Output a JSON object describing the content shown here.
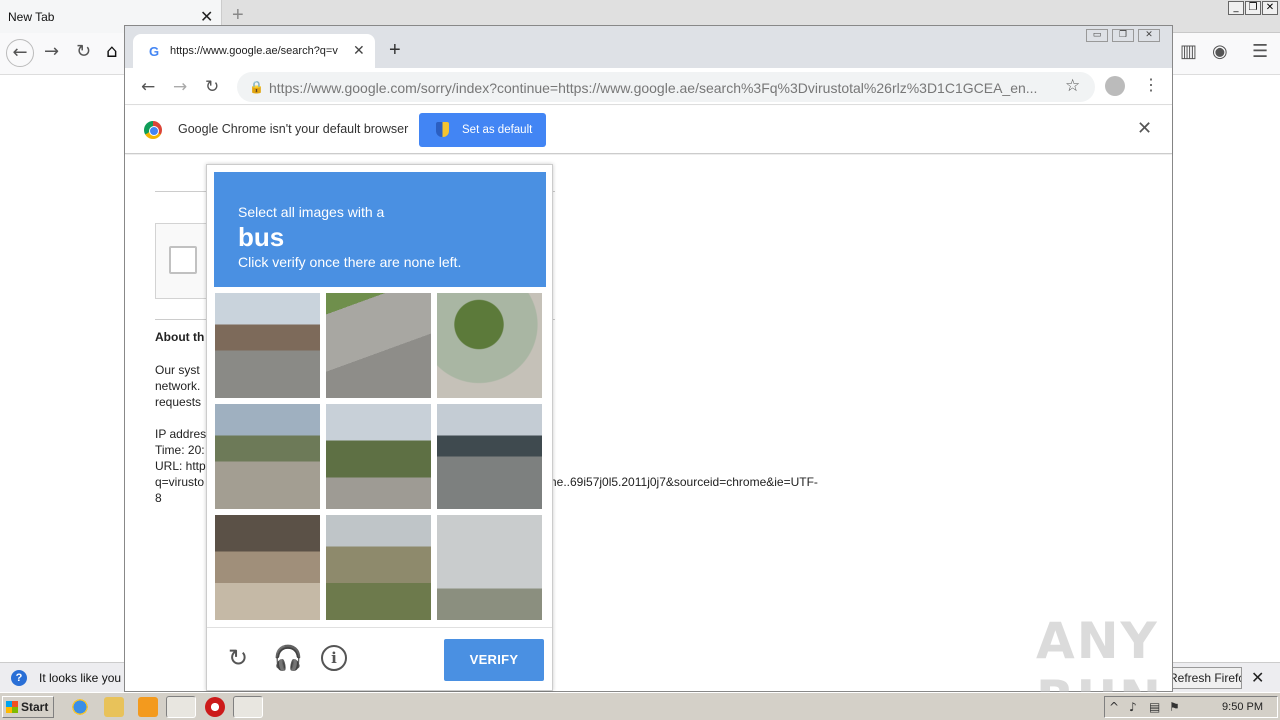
{
  "firefox": {
    "tab_title": "New Tab",
    "tab_close": "✕",
    "new_tab": "+",
    "window_controls": [
      "_",
      "❐",
      "✕"
    ],
    "notification": {
      "text": "It looks like you h",
      "refresh_button": "Refresh Firefox…",
      "close": "✕"
    }
  },
  "chrome": {
    "tab": {
      "favicon": "G",
      "title": "https://www.google.ae/search?q=v",
      "close": "✕"
    },
    "new_tab": "+",
    "window_controls": [
      "▭",
      "❐",
      "✕"
    ],
    "url": "https://www.google.com/sorry/index?continue=https://www.google.ae/search%3Fq%3Dvirustotal%26rlz%3D1C1GCEA_en...",
    "infobar": {
      "text": "Google Chrome isn't your default browser",
      "button": "Set as default",
      "close": "✕"
    }
  },
  "page": {
    "about_heading": "About th",
    "lines": [
      "Our syst",
      "network.",
      "requests",
      "",
      "IP addres",
      "Time: 20:",
      "URL: http",
      "q=virusto",
      "8"
    ],
    "url_overflow": "ome..69i57j0l5.2011j0j7&sourceid=chrome&ie=UTF-"
  },
  "captcha": {
    "line1": "Select all images with a",
    "target": "bus",
    "line2": "Click verify once there are none left.",
    "verify_label": "VERIFY",
    "tiles": [
      "street intersection with buildings",
      "empty road and sidewalk",
      "palm trees",
      "road with trees and cars",
      "traffic light intersection",
      "highway overpass",
      "underpass bridge",
      "palm trees and hedge",
      "utility poles"
    ]
  },
  "watermark": "ANY RUN",
  "taskbar": {
    "start": "Start",
    "time": "9:50 PM"
  }
}
